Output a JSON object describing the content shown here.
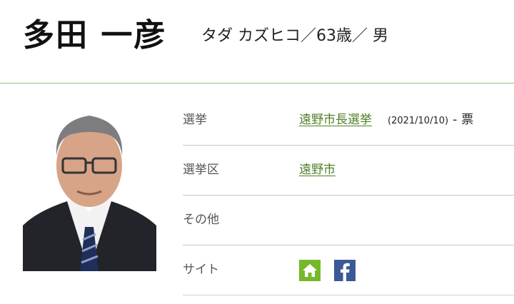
{
  "candidate": {
    "name": "多田 一彦",
    "kana_line": "タダ カズヒコ／63歳／ 男"
  },
  "profile": {
    "rows": [
      {
        "label": "選挙",
        "link": "遠野市長選挙",
        "date": "(2021/10/10)",
        "sep": "-",
        "votes": "票"
      },
      {
        "label": "選挙区",
        "link": "遠野市"
      },
      {
        "label": "その他"
      },
      {
        "label": "サイト"
      }
    ]
  },
  "site_icons": [
    {
      "name": "home-icon",
      "color": "#76b82a"
    },
    {
      "name": "facebook-icon",
      "color": "#3b5998"
    }
  ]
}
